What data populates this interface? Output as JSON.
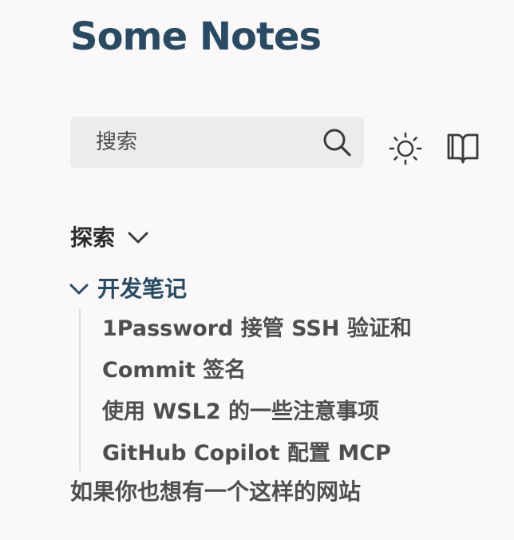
{
  "site": {
    "title": "Some Notes"
  },
  "search": {
    "placeholder": "搜索",
    "icon": "search-icon"
  },
  "toolbar": {
    "theme_icon": "sun-icon",
    "reader_icon": "book-icon"
  },
  "explorer": {
    "title": "探索",
    "expanded": true,
    "folders": [
      {
        "label": "开发笔记",
        "expanded": true,
        "notes": [
          {
            "label": "1Password 接管 SSH 验证和 Commit 签名"
          },
          {
            "label": "使用 WSL2 的一些注意事项"
          },
          {
            "label": "GitHub Copilot 配置 MCP"
          }
        ]
      }
    ],
    "pages": [
      {
        "label": "如果你也想有一个这样的网站"
      }
    ]
  },
  "colors": {
    "background": "#faf8f8",
    "accent": "#284b63",
    "text": "#4e4e4e",
    "search_bg": "#ececec"
  }
}
